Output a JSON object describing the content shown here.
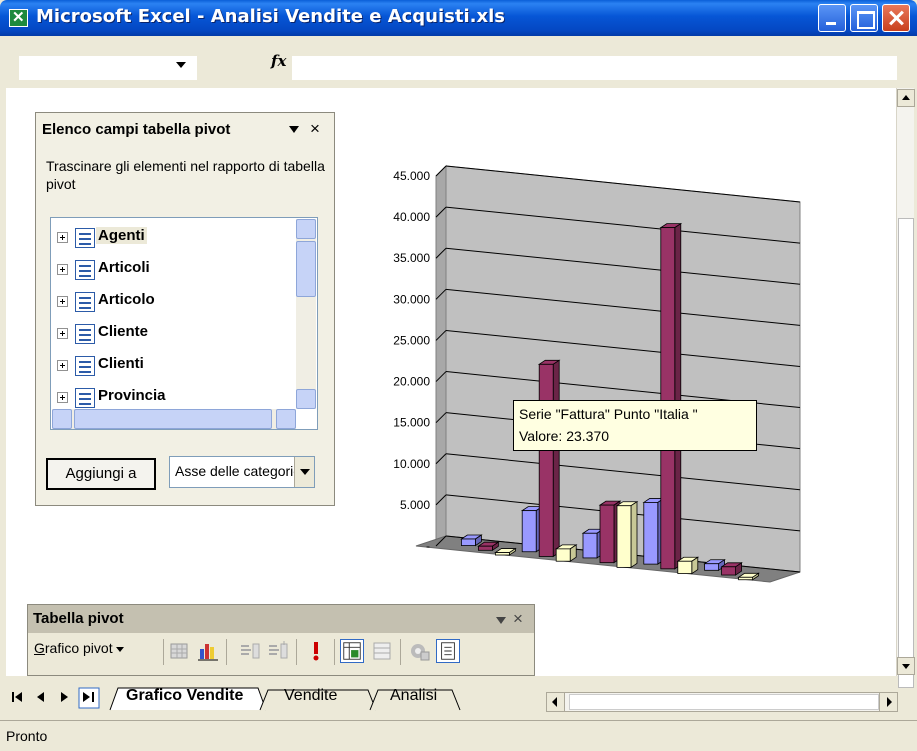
{
  "window": {
    "title": "Microsoft Excel - Analisi Vendite e Acquisti.xls"
  },
  "formula_bar": {
    "fx_label": "fx",
    "name_box_value": "",
    "formula_value": ""
  },
  "pivot_field_list": {
    "title": "Elenco campi tabella pivot",
    "close_label": "×",
    "description": "Trascinare gli elementi nel rapporto di tabella pivot",
    "fields": [
      "Agenti",
      "Articoli",
      "Articolo",
      "Cliente",
      "Clienti",
      "Provincia"
    ],
    "selected_field": "Agenti",
    "add_button_label": "Aggiungi a",
    "axis_select_value": "Asse delle categorie"
  },
  "tooltip": {
    "line1": "Serie \"Fattura\" Punto \"Italia \"",
    "line2": "Valore:  23.370"
  },
  "pivot_toolbar": {
    "title": "Tabella pivot",
    "close_label": "×",
    "menu_prefix": "G",
    "menu_rest": "rafico pivot"
  },
  "sheet_tabs": {
    "nav_buttons": [
      "|◄",
      "◄",
      "►",
      "►|"
    ],
    "tabs": [
      "Grafico Vendite",
      "Vendite",
      "Analisi"
    ],
    "active": "Grafico Vendite"
  },
  "status": {
    "text": "Pronto"
  },
  "colors": {
    "blue": "#9999ff",
    "maroon": "#993366",
    "cream": "#ffffcc",
    "wall": "#c0c0c0"
  },
  "chart_data": {
    "type": "bar",
    "title": "",
    "ylim": [
      0,
      45000
    ],
    "yticks": [
      "45.000",
      "40.000",
      "35.000",
      "30.000",
      "25.000",
      "20.000",
      "15.000",
      "10.000",
      "5.000",
      "-"
    ],
    "categories": [
      "",
      "",
      "",
      "",
      ""
    ],
    "series": [
      {
        "values": [
          800,
          5000,
          3000,
          7500,
          800
        ]
      },
      {
        "name": "Fattura",
        "values": [
          500,
          23370,
          7000,
          41500,
          1000
        ]
      },
      {
        "values": [
          300,
          1500,
          7500,
          1500,
          300
        ]
      }
    ]
  }
}
